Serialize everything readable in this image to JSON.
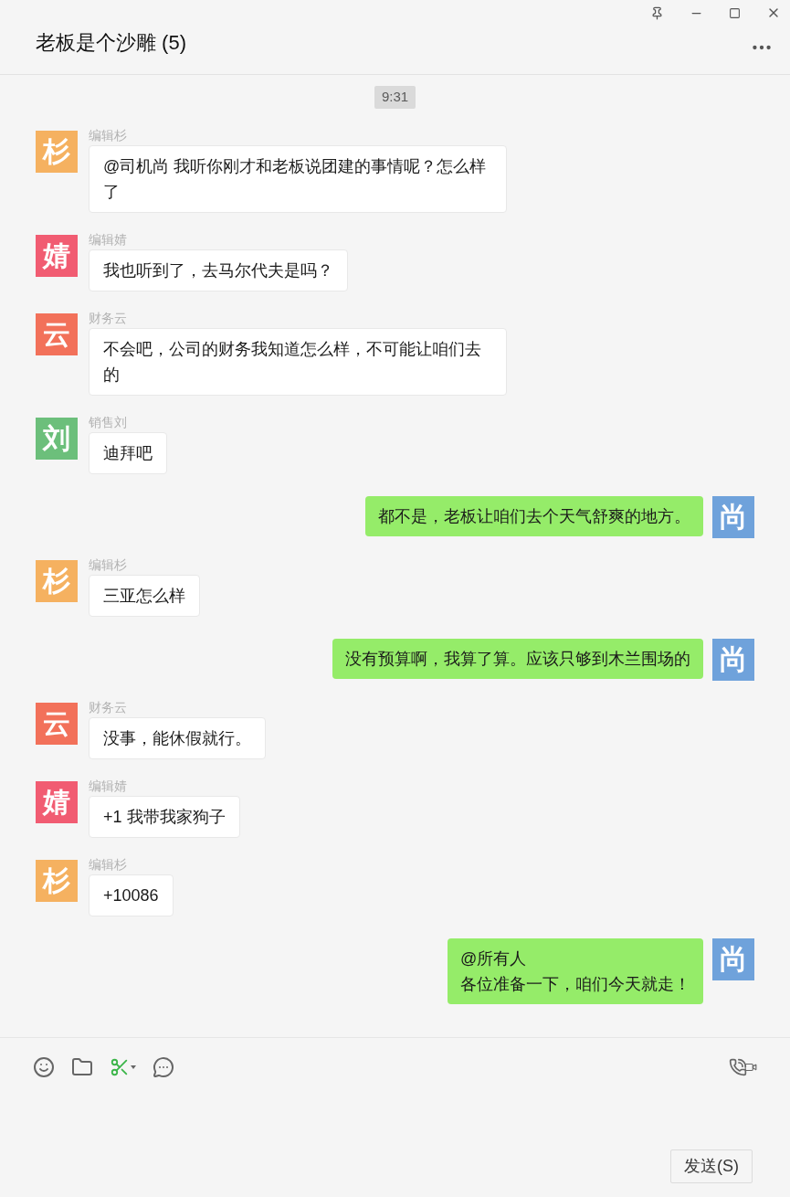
{
  "window": {
    "title": "老板是个沙雕 (5)"
  },
  "time": "9:31",
  "messages": [
    {
      "kind": "received",
      "sender": "编辑杉",
      "avatar": "杉",
      "color": "#f5b160",
      "text": "@司机尚 我听你刚才和老板说团建的事情呢？怎么样了"
    },
    {
      "kind": "received",
      "sender": "编辑婧",
      "avatar": "婧",
      "color": "#f15c72",
      "text": "我也听到了，去马尔代夫是吗？"
    },
    {
      "kind": "received",
      "sender": "财务云",
      "avatar": "云",
      "color": "#f2715a",
      "text": "不会吧，公司的财务我知道怎么样，不可能让咱们去的"
    },
    {
      "kind": "received",
      "sender": "销售刘",
      "avatar": "刘",
      "color": "#6cbf7b",
      "text": "迪拜吧"
    },
    {
      "kind": "sent",
      "avatar": "尚",
      "color": "#6fa2db",
      "text": "都不是，老板让咱们去个天气舒爽的地方。"
    },
    {
      "kind": "received",
      "sender": "编辑杉",
      "avatar": "杉",
      "color": "#f5b160",
      "text": "三亚怎么样"
    },
    {
      "kind": "sent",
      "avatar": "尚",
      "color": "#6fa2db",
      "text": "没有预算啊，我算了算。应该只够到木兰围场的"
    },
    {
      "kind": "received",
      "sender": "财务云",
      "avatar": "云",
      "color": "#f2715a",
      "text": "没事，能休假就行。"
    },
    {
      "kind": "received",
      "sender": "编辑婧",
      "avatar": "婧",
      "color": "#f15c72",
      "text": "+1 我带我家狗子"
    },
    {
      "kind": "received",
      "sender": "编辑杉",
      "avatar": "杉",
      "color": "#f5b160",
      "text": "+10086"
    },
    {
      "kind": "sent",
      "avatar": "尚",
      "color": "#6fa2db",
      "lines": [
        "@所有人",
        "各位准备一下，咱们今天就走！"
      ]
    }
  ],
  "send_button": "发送(S)"
}
